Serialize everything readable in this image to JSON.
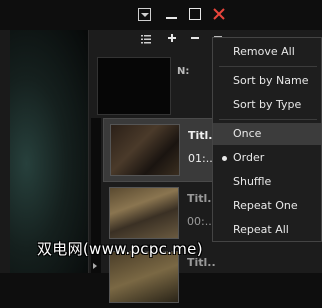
{
  "titlebar": {
    "menu_icon": "dropdown-menu-icon",
    "minimize_icon": "minimize-icon",
    "maximize_icon": "maximize-icon",
    "close_icon": "close-icon",
    "close_color": "#e8453c"
  },
  "playlist": {
    "toolbar": {
      "list_icon": "list-icon",
      "add_icon": "plus-icon",
      "remove_icon": "minus-icon",
      "sort_icon": "sort-menu-icon"
    },
    "now_playing_label": "N:",
    "items": [
      {
        "title": "Titl..",
        "duration": "01:..",
        "state": "active"
      },
      {
        "title": "Titl..",
        "duration": "00:..",
        "state": "normal"
      },
      {
        "title": "Titl..",
        "duration": "",
        "state": "normal"
      }
    ]
  },
  "context_menu": {
    "items": [
      {
        "label": "Remove All"
      },
      {
        "label": "Sort by Name"
      },
      {
        "label": "Sort by Type"
      },
      {
        "label": "Once",
        "hovered": true
      },
      {
        "label": "Order",
        "selected": true
      },
      {
        "label": "Shuffle"
      },
      {
        "label": "Repeat One"
      },
      {
        "label": "Repeat All"
      }
    ]
  },
  "watermark": "双电网(www.pcpc.me)"
}
